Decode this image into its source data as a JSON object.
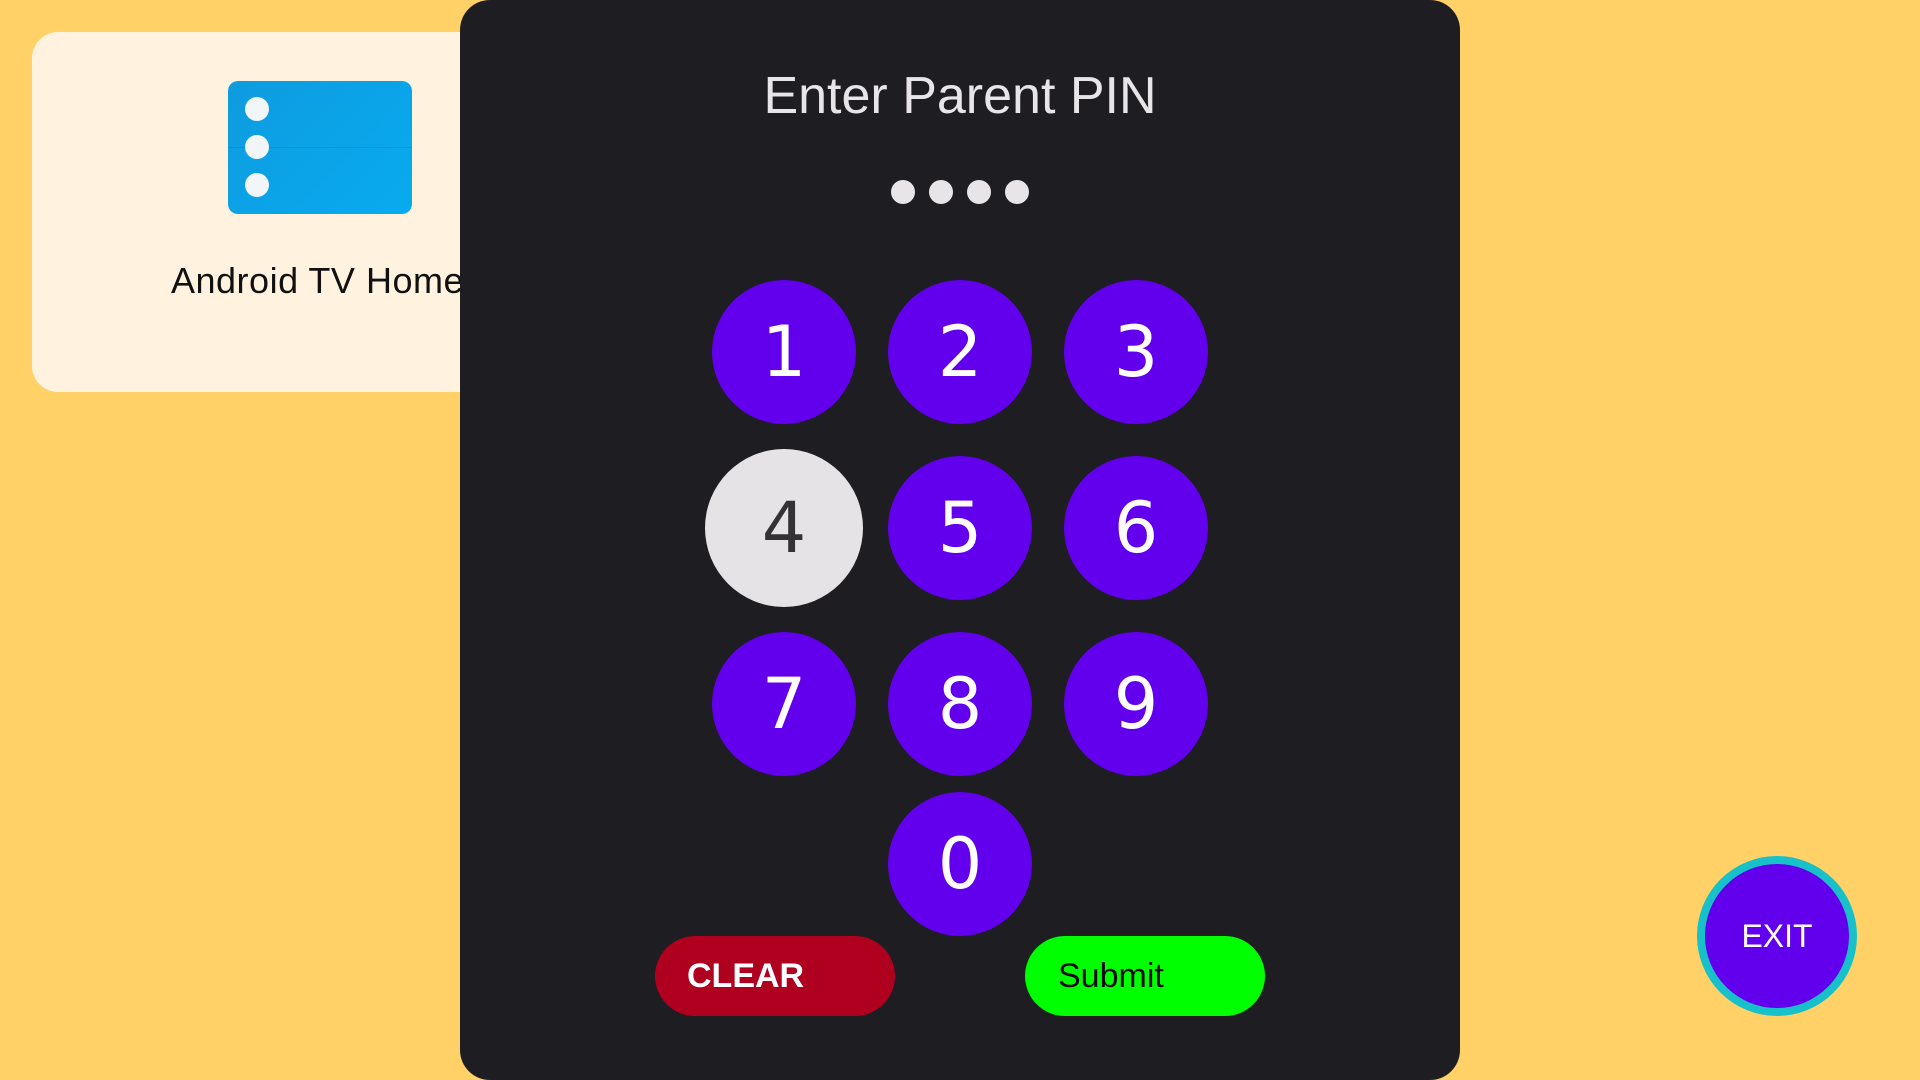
{
  "background_color": "#FFD166",
  "app_tile": {
    "label": "Android TV Home",
    "icon": "tv-home-settings-icon",
    "icon_color": "#0BA4E8"
  },
  "pin_dialog": {
    "title": "Enter Parent PIN",
    "pin_masked": "••••",
    "entered_digits_count": 4,
    "keypad": [
      "1",
      "2",
      "3",
      "4",
      "5",
      "6",
      "7",
      "8",
      "9",
      "0"
    ],
    "focused_key": "4",
    "clear_label": "CLEAR",
    "submit_label": "Submit",
    "colors": {
      "dialog_bg": "#1E1D22",
      "key_bg": "#6200EE",
      "key_focused_bg": "#E6E3E6",
      "clear_bg": "#B0001F",
      "submit_bg": "#00FF00"
    }
  },
  "exit_button": {
    "label": "EXIT",
    "ring_color": "#18C1C9"
  }
}
